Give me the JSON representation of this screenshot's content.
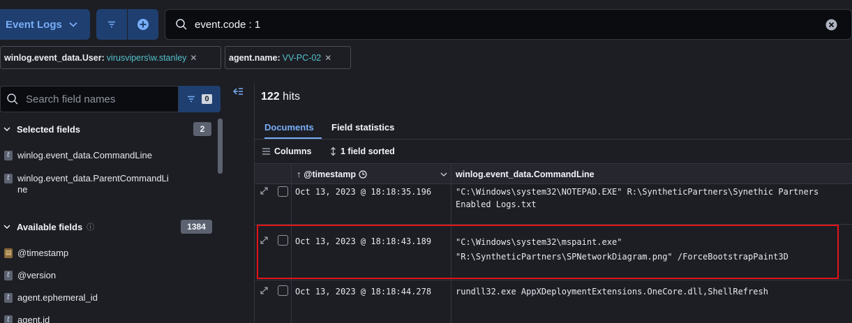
{
  "query_bar": {
    "data_view_label": "Event Logs",
    "query": "event.code : 1"
  },
  "filters": [
    {
      "field": "winlog.event_data.User:",
      "value": "virusvipers\\w.stanley"
    },
    {
      "field": "agent.name:",
      "value": "VV-PC-02"
    }
  ],
  "sidebar": {
    "search_placeholder": "Search field names",
    "filter_count": "0",
    "selected_section": {
      "label": "Selected fields",
      "count": "2",
      "fields": [
        "winlog.event_data.CommandLine",
        "winlog.event_data.ParentCommandLi",
        "ne"
      ]
    },
    "available_section": {
      "label": "Available fields",
      "count": "1384",
      "fields": [
        "@timestamp",
        "@version",
        "agent.ephemeral_id",
        "agent.id"
      ]
    }
  },
  "main": {
    "hits_count": "122",
    "hits_label": "hits",
    "tabs": [
      "Documents",
      "Field statistics"
    ],
    "toolbar": {
      "columns_label": "Columns",
      "sort_label": "1 field sorted"
    },
    "columns": [
      "@timestamp",
      "winlog.event_data.CommandLine"
    ],
    "rows": [
      {
        "timestamp": "Oct 13, 2023 @ 18:18:35.196",
        "cmd_line1": "\"C:\\Windows\\system32\\NOTEPAD.EXE\" R:\\SyntheticPartners\\Synethic Partners",
        "cmd_line2": "Enabled Logs.txt"
      },
      {
        "timestamp": "Oct 13, 2023 @ 18:18:43.189",
        "cmd_line1": "\"C:\\Windows\\system32\\mspaint.exe\"",
        "cmd_line2": "\"R:\\SyntheticPartners\\SPNetworkDiagram.png\" /ForceBootstrapPaint3D"
      },
      {
        "timestamp": "Oct 13, 2023 @ 18:18:44.278",
        "cmd_line1": "rundll32.exe AppXDeploymentExtensions.OneCore.dll,ShellRefresh",
        "cmd_line2": ""
      }
    ]
  },
  "icons": [
    "chevron-down-icon",
    "filter-icon",
    "plus-circle-icon",
    "search-icon",
    "clear-icon",
    "close-icon",
    "collapse-icon",
    "expand-icon",
    "clock-icon",
    "sort-icon",
    "columns-icon",
    "help-icon"
  ],
  "colors": {
    "accent": "#78aef8",
    "highlight": "#e3121a",
    "value_text": "#54c1cb"
  }
}
